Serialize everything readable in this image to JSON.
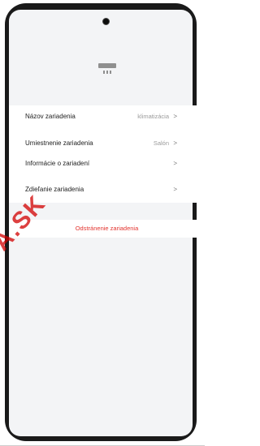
{
  "device_settings": {
    "rows": [
      {
        "label": "Názov zariadenia",
        "value": "klimatizácia",
        "chevron": ">"
      },
      {
        "label": "Umiestnenie zariadenia",
        "value": "Salón",
        "chevron": ">"
      },
      {
        "label": "Informácie o zariadení",
        "value": "",
        "chevron": ">"
      },
      {
        "label": "Zdieľanie zariadenia",
        "value": "",
        "chevron": ">"
      }
    ],
    "remove_label": "Odstránenie zariadenia"
  },
  "watermark": {
    "text": "PA.SK"
  },
  "colors": {
    "danger": "#e3342f",
    "watermark": "#d20000",
    "phone_frame": "#1a1a1a"
  }
}
